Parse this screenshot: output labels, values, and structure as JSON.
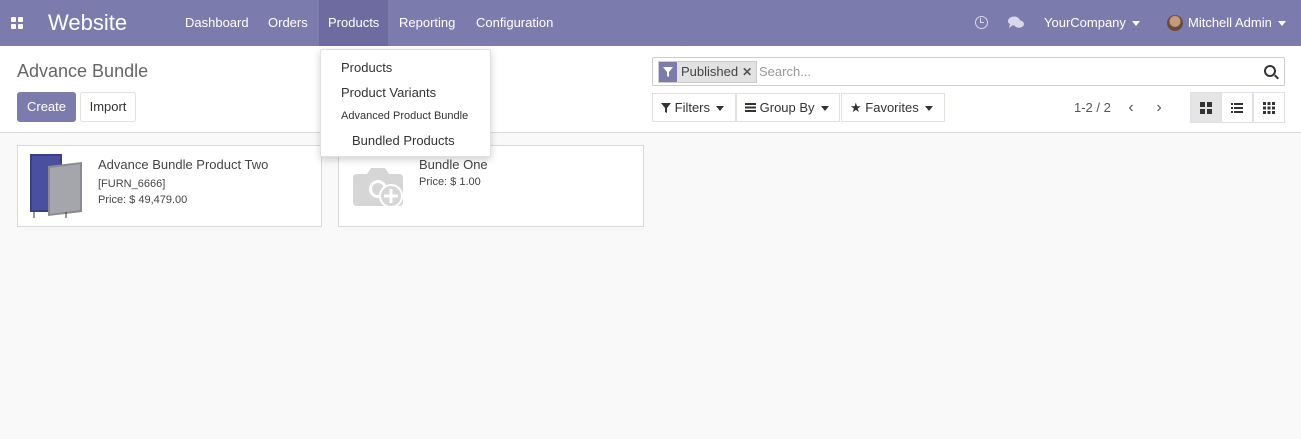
{
  "navbar": {
    "brand": "Website",
    "menus": [
      "Dashboard",
      "Orders",
      "Products",
      "Reporting",
      "Configuration"
    ],
    "company": "YourCompany",
    "user": "Mitchell Admin",
    "color": "#7c7bad"
  },
  "products_menu": {
    "items": [
      "Products",
      "Product Variants",
      "Advanced Product Bundle",
      "Bundled Products"
    ]
  },
  "control_panel": {
    "title": "Advance Bundle",
    "create_label": "Create",
    "import_label": "Import",
    "facet_label": "Published",
    "search_placeholder": "Search...",
    "filters_label": "Filters",
    "groupby_label": "Group By",
    "favorites_label": "Favorites",
    "pager": "1-2 / 2"
  },
  "cards": [
    {
      "name": "Advance Bundle Product Two",
      "ref": "[FURN_6666]",
      "price": "Price: $ 49,479.00"
    },
    {
      "name": "Bundle One",
      "price": "Price: $ 1.00"
    }
  ]
}
